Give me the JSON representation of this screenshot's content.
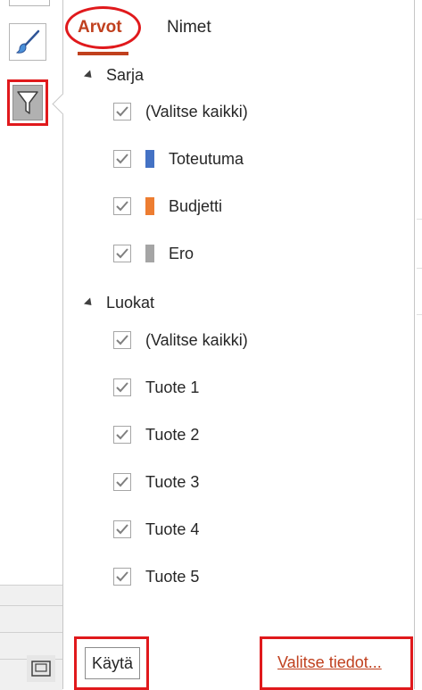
{
  "tabs": {
    "values": "Arvot",
    "names": "Nimet"
  },
  "series_section": {
    "header": "Sarja",
    "items": [
      {
        "label": "(Valitse kaikki)",
        "checked": true,
        "color": ""
      },
      {
        "label": "Toteutuma",
        "checked": true,
        "color": "#4472C4"
      },
      {
        "label": "Budjetti",
        "checked": true,
        "color": "#ED7D31"
      },
      {
        "label": "Ero",
        "checked": true,
        "color": "#A5A5A5"
      }
    ]
  },
  "categories_section": {
    "header": "Luokat",
    "items": [
      {
        "label": "(Valitse kaikki)",
        "checked": true
      },
      {
        "label": "Tuote 1",
        "checked": true
      },
      {
        "label": "Tuote 2",
        "checked": true
      },
      {
        "label": "Tuote 3",
        "checked": true
      },
      {
        "label": "Tuote 4",
        "checked": true
      },
      {
        "label": "Tuote 5",
        "checked": true
      }
    ]
  },
  "footer": {
    "apply_label": "Käytä",
    "select_data_label": "Valitse tiedot..."
  },
  "colors": {
    "accent": "#C0401E",
    "highlight": "#E0191C"
  },
  "icons": {
    "style_button": "paintbrush-icon",
    "filter_button": "funnel-icon",
    "layout_button": "layout-icon"
  }
}
